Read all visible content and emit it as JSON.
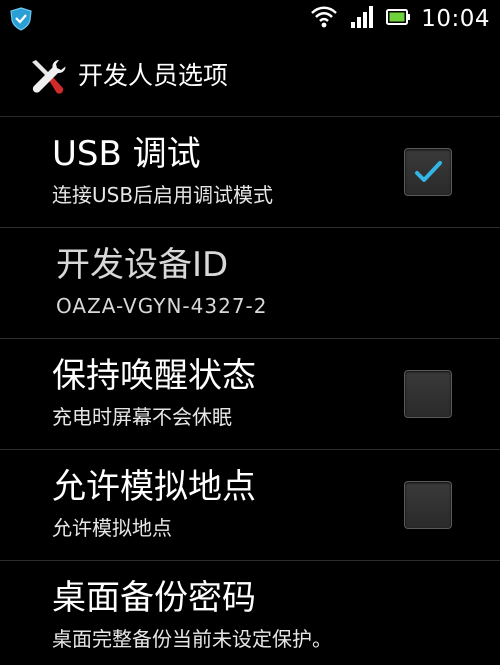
{
  "status_bar": {
    "time": "10:04",
    "icons": [
      "shield-icon",
      "wifi-icon",
      "signal-icon",
      "battery-icon"
    ]
  },
  "action_bar": {
    "icon": "tools-icon",
    "title": "开发人员选项"
  },
  "preferences": [
    {
      "title": "USB 调试",
      "summary": "连接USB后启用调试模式",
      "has_checkbox": true,
      "checked": true
    },
    {
      "title": "开发设备ID",
      "summary": "OAZA-VGYN-4327-2",
      "has_checkbox": false
    },
    {
      "title": "保持唤醒状态",
      "summary": "充电时屏幕不会休眠",
      "has_checkbox": true,
      "checked": false
    },
    {
      "title": "允许模拟地点",
      "summary": "允许模拟地点",
      "has_checkbox": true,
      "checked": false
    },
    {
      "title": "桌面备份密码",
      "summary": "桌面完整备份当前未设定保护。",
      "has_checkbox": false
    }
  ],
  "colors": {
    "background": "#000000",
    "check_accent": "#33b5e5"
  }
}
